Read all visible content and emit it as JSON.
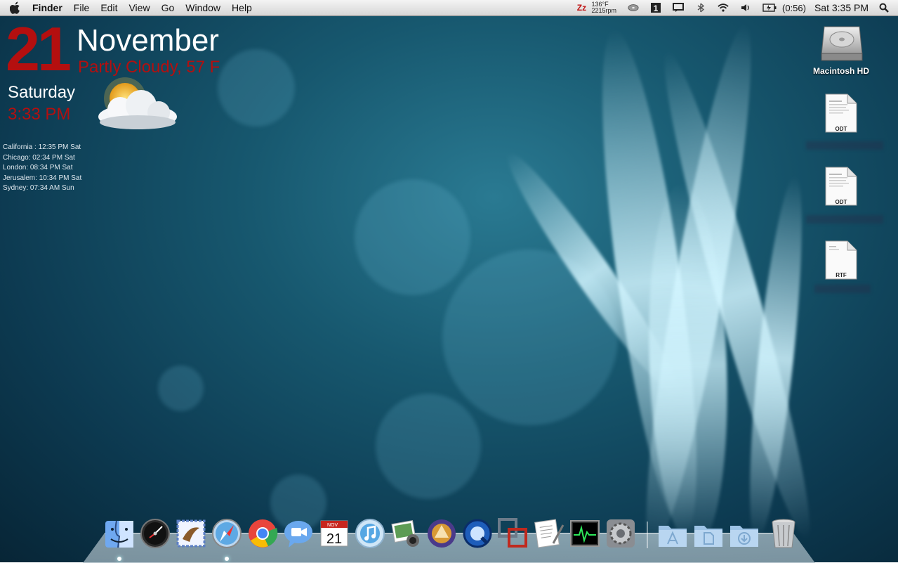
{
  "menubar": {
    "app_name": "Finder",
    "menus": [
      "File",
      "Edit",
      "View",
      "Go",
      "Window",
      "Help"
    ],
    "status": {
      "temperature": "136°F",
      "fan_speed": "2215rpm",
      "battery_time": "(0:56)",
      "datetime": "Sat 3:35 PM"
    },
    "icons": [
      "apple-icon",
      "smcfan-icon",
      "disc-icon",
      "one-icon",
      "message-icon",
      "bluetooth-icon",
      "wifi-icon",
      "volume-icon",
      "battery-icon",
      "spotlight-icon"
    ]
  },
  "widget": {
    "day_number": "21",
    "month": "November",
    "weather": "Partly Cloudy, 57 F",
    "weekday": "Saturday",
    "time": "3:33 PM"
  },
  "world_clock": [
    "California : 12:35 PM Sat",
    "Chicago: 02:34 PM Sat",
    "London: 08:34 PM Sat",
    "Jerusalem: 10:34 PM Sat",
    "Sydney: 07:34 AM Sun"
  ],
  "desktop_icons": {
    "hd_label": "Macintosh HD",
    "files": [
      {
        "type": "ODT"
      },
      {
        "type": "ODT"
      },
      {
        "type": "RTF"
      }
    ]
  },
  "dock": {
    "apps": [
      "Finder",
      "Dashboard",
      "Mail",
      "Safari",
      "Google Chrome",
      "iChat",
      "iCal",
      "iTunes",
      "iPhoto",
      "Address Book",
      "QuickTime Player",
      "VMware Fusion",
      "TextEdit",
      "Activity Monitor",
      "System Preferences"
    ],
    "calendar_month": "NOV",
    "calendar_day": "21",
    "folders": [
      "Applications",
      "Documents",
      "Downloads"
    ],
    "trash": "Trash"
  },
  "colors": {
    "accent_red": "#b40f0f",
    "desktop_blue": "#17586f",
    "menubar": "#e6e6e6"
  }
}
